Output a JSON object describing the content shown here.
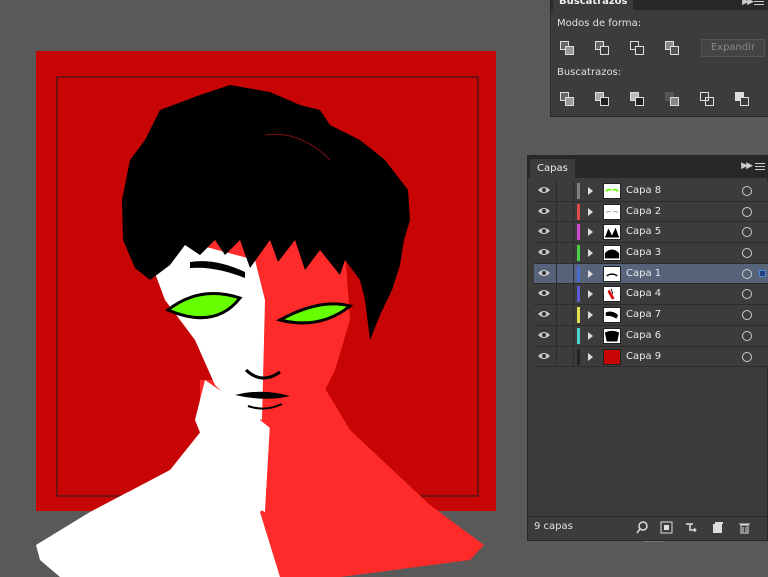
{
  "pathfinder": {
    "tab": "Buscatrazos",
    "shape_modes_label": "Modos de forma:",
    "pathfinders_label": "Buscatrazos:",
    "expand_label": "Expandir",
    "shape_mode_icons": [
      "unite-icon",
      "minus-front-icon",
      "intersect-icon",
      "exclude-icon"
    ],
    "pathfinder_icons": [
      "divide-icon",
      "trim-icon",
      "merge-icon",
      "crop-icon",
      "outline-icon",
      "minus-back-icon"
    ]
  },
  "layers": {
    "tab": "Capas",
    "count_label": "9 capas",
    "selected_index": 4,
    "rows": [
      {
        "name": "Capa 8",
        "color": "#7f7f7f"
      },
      {
        "name": "Capa 2",
        "color": "#e04a4a"
      },
      {
        "name": "Capa 5",
        "color": "#d24ad2"
      },
      {
        "name": "Capa 3",
        "color": "#4ad24a"
      },
      {
        "name": "Capa 1",
        "color": "#4a6ad2"
      },
      {
        "name": "Capa 4",
        "color": "#5a5ad2"
      },
      {
        "name": "Capa 7",
        "color": "#e0e04a"
      },
      {
        "name": "Capa 6",
        "color": "#4ad2d2"
      },
      {
        "name": "Capa 9",
        "color": "#222222"
      }
    ],
    "footer_icons": [
      "locate-object-icon",
      "make-clipping-mask-icon",
      "create-sublayer-icon",
      "new-layer-icon",
      "delete-icon"
    ]
  },
  "colors": {
    "canvas": "#595959",
    "artboard": "#c80505",
    "skin_red": "#ff2a2a",
    "eye_green": "#66ff00",
    "panel_bg": "#3c3c3c",
    "selection": "#566378"
  }
}
